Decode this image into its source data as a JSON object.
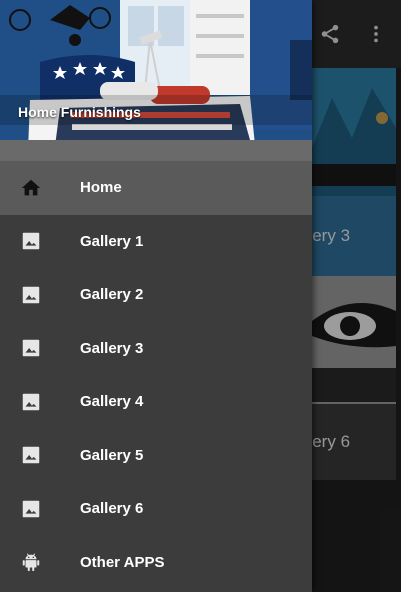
{
  "app": {
    "header_title": "Home Furnishings"
  },
  "menu": {
    "items": [
      {
        "label": "Home",
        "icon": "home-icon",
        "active": true
      },
      {
        "label": "Gallery 1",
        "icon": "image-icon"
      },
      {
        "label": "Gallery 2",
        "icon": "image-icon"
      },
      {
        "label": "Gallery 3",
        "icon": "image-icon"
      },
      {
        "label": "Gallery 4",
        "icon": "image-icon"
      },
      {
        "label": "Gallery 5",
        "icon": "image-icon"
      },
      {
        "label": "Gallery 6",
        "icon": "image-icon"
      },
      {
        "label": "Other APPS",
        "icon": "android-icon"
      }
    ]
  },
  "background": {
    "tiles": [
      {
        "label": "Gallery 3"
      },
      {
        "label": "Gallery 6"
      }
    ],
    "actions": [
      "share-icon",
      "more-vert-icon"
    ]
  },
  "colors": {
    "drawer_bg": "#3c3c3c",
    "active_item": "#5a5a5a",
    "appbar": "#2b2b2b",
    "tile_blue": "#2f6f99"
  }
}
